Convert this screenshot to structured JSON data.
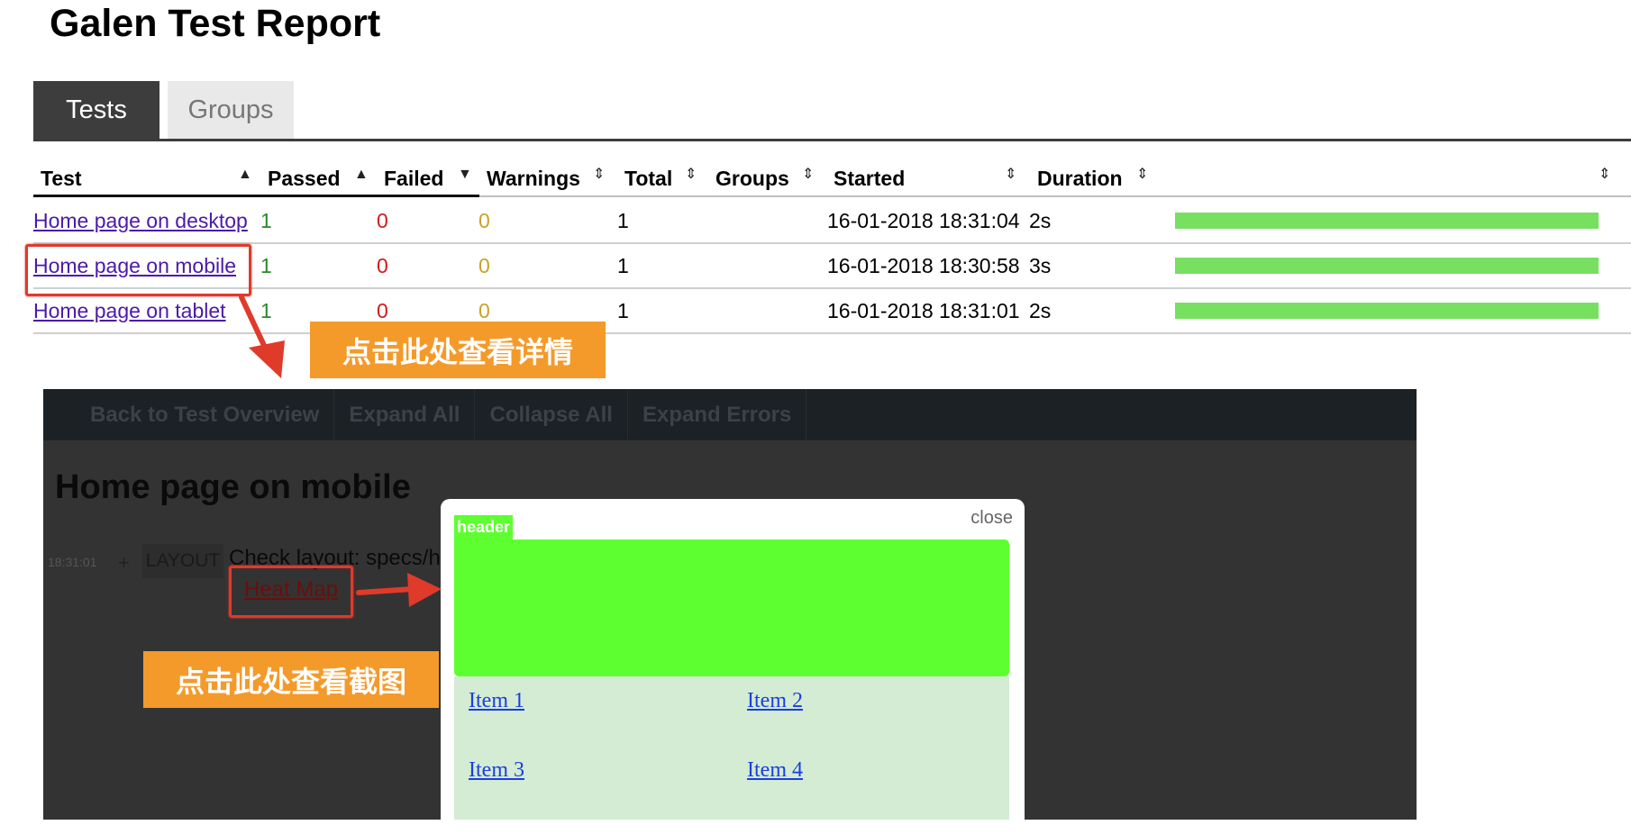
{
  "report": {
    "title": "Galen Test Report"
  },
  "tabs": [
    {
      "label": "Tests",
      "active": true
    },
    {
      "label": "Groups",
      "active": false
    }
  ],
  "table": {
    "columns": [
      "Test",
      "Passed",
      "Failed",
      "Warnings",
      "Total",
      "Groups",
      "Started",
      "Duration",
      ""
    ],
    "rows": [
      {
        "test": "Home page on desktop",
        "passed": "1",
        "failed": "0",
        "warnings": "0",
        "total": "1",
        "groups": "",
        "started": "16-01-2018 18:31:04",
        "duration": "2s",
        "progress": 1.0
      },
      {
        "test": "Home page on mobile",
        "passed": "1",
        "failed": "0",
        "warnings": "0",
        "total": "1",
        "groups": "",
        "started": "16-01-2018 18:30:58",
        "duration": "3s",
        "progress": 1.0
      },
      {
        "test": "Home page on tablet",
        "passed": "1",
        "failed": "0",
        "warnings": "0",
        "total": "1",
        "groups": "",
        "started": "16-01-2018 18:31:01",
        "duration": "2s",
        "progress": 1.0
      }
    ]
  },
  "callouts": {
    "details": "点击此处查看详情",
    "screenshot": "点击此处查看截图"
  },
  "detail": {
    "nav": [
      "Back to Test Overview",
      "Expand All",
      "Collapse All",
      "Expand Errors"
    ],
    "title": "Home page on mobile",
    "time": "18:31:01",
    "plus": "+",
    "tag": "LAYOUT",
    "check_text": "Check layout: specs/h",
    "heatmap_link": "Heat Map"
  },
  "popup": {
    "close": "close",
    "header_label": "header",
    "items": [
      "Item 1",
      "Item 2",
      "Item 3",
      "Item 4"
    ]
  },
  "colors": {
    "accent": "#3d3d3d",
    "callout": "#f49a2a",
    "highlight": "#e03a2a",
    "passed": "#2a8a2a",
    "failed": "#d11a1a",
    "warning": "#c9a227",
    "progress": "#77e061",
    "header_green": "#5eff30"
  }
}
